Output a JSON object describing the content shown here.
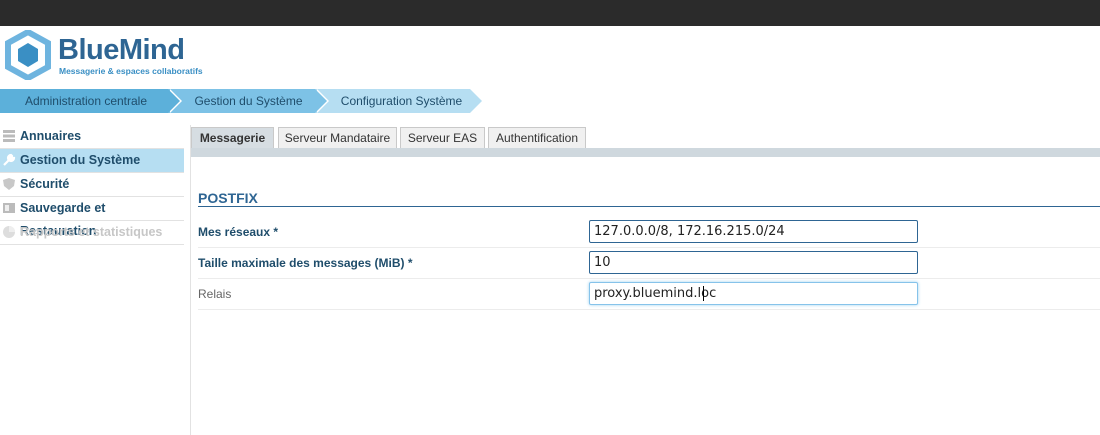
{
  "logo": {
    "title": "BlueMind",
    "subtitle": "Messagerie & espaces collaboratifs"
  },
  "breadcrumb": [
    {
      "label": "Administration centrale"
    },
    {
      "label": "Gestion du Système"
    },
    {
      "label": "Configuration Système"
    }
  ],
  "sidebar": {
    "items": [
      {
        "label": "Annuaires",
        "icon": "directory-icon"
      },
      {
        "label": "Gestion du Système",
        "icon": "wrench-icon",
        "active": true
      },
      {
        "label": "Sécurité",
        "icon": "shield-icon"
      },
      {
        "label": "Sauvegarde et Restauration",
        "icon": "backup-icon"
      },
      {
        "label": "Rapports et statistiques",
        "icon": "reports-icon",
        "disabled": true
      }
    ]
  },
  "tabs": [
    {
      "label": "Messagerie",
      "active": true
    },
    {
      "label": "Serveur Mandataire"
    },
    {
      "label": "Serveur EAS"
    },
    {
      "label": "Authentification"
    }
  ],
  "section": {
    "title": "POSTFIX"
  },
  "fields": {
    "networks": {
      "label": "Mes réseaux *",
      "value": "127.0.0.0/8, 172.16.215.0/24"
    },
    "max_size": {
      "label": "Taille maximale des messages (MiB) *",
      "value": "10"
    },
    "relay": {
      "label": "Relais",
      "value": "proxy.bluemind.loc"
    }
  },
  "colors": {
    "accent": "#2e6593",
    "crumb1": "#5cb0da",
    "crumb2": "#7dc2e6",
    "crumb3": "#b6def2",
    "topbar": "#2b2b2b"
  }
}
